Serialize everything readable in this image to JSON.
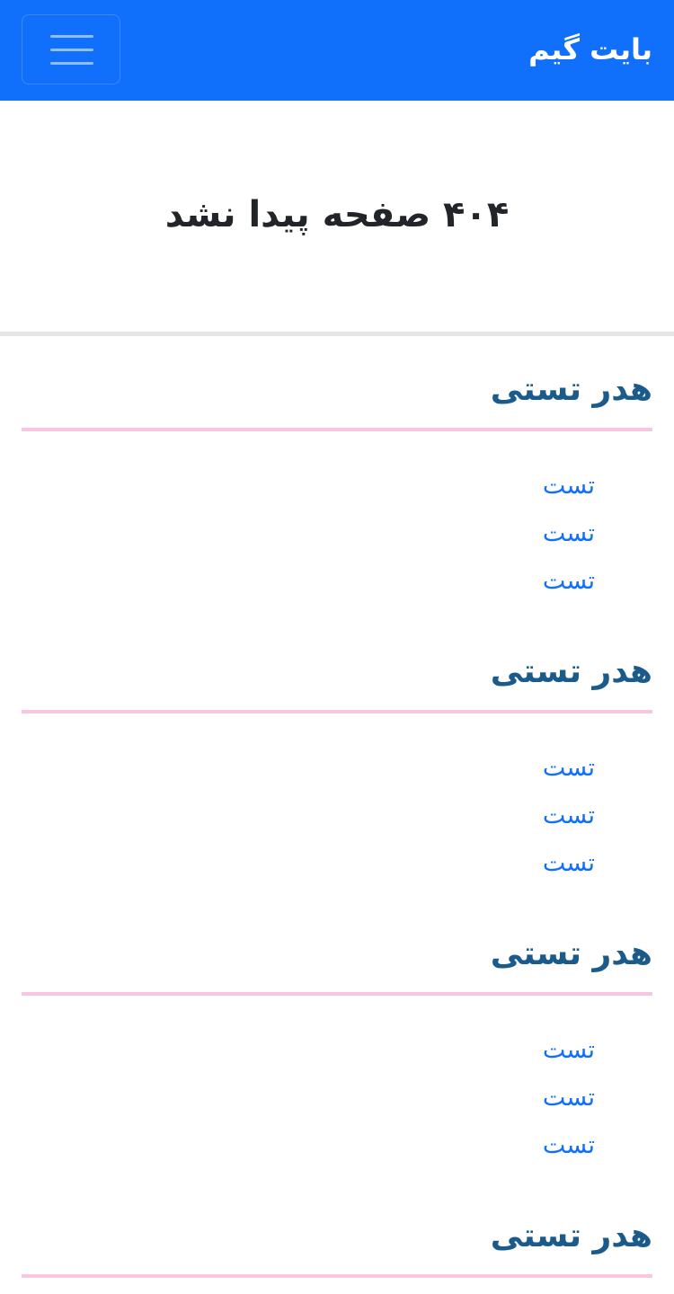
{
  "navbar": {
    "brand": "بایت گیم",
    "toggler_icon": "hamburger-menu-icon",
    "background_color": "#1170fb"
  },
  "main": {
    "title": "۴۰۴ صفحه پیدا نشد"
  },
  "footer": {
    "sections": [
      {
        "header": "هدر تستی",
        "links": [
          "تست",
          "تست",
          "تست"
        ]
      },
      {
        "header": "هدر تستی",
        "links": [
          "تست",
          "تست",
          "تست"
        ]
      },
      {
        "header": "هدر تستی",
        "links": [
          "تست",
          "تست",
          "تست"
        ]
      },
      {
        "header": "هدر تستی",
        "links": []
      }
    ],
    "header_color": "#1a5b8c",
    "rule_color": "#f9c6e1",
    "link_color": "#1170fb"
  }
}
